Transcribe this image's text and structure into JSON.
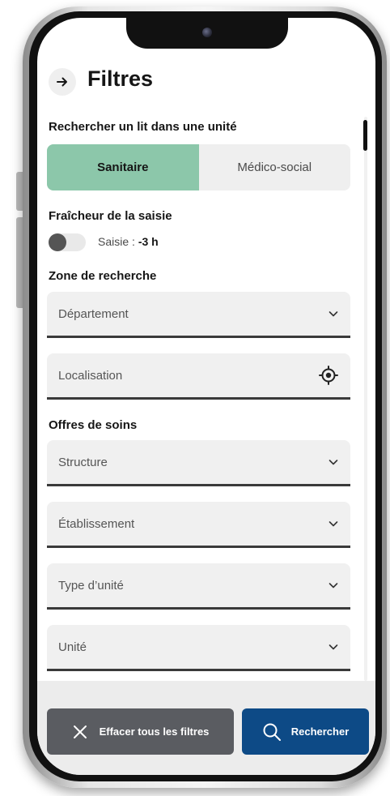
{
  "header": {
    "title": "Filtres"
  },
  "unit_search": {
    "label": "Rechercher un lit dans une unité",
    "options": [
      "Sanitaire",
      "Médico-social"
    ],
    "selected": "Sanitaire"
  },
  "freshness": {
    "label": "Fraîcheur de la saisie",
    "toggle_prefix": "Saisie : ",
    "toggle_value": "-3 h",
    "enabled": false
  },
  "zone": {
    "label": "Zone de recherche",
    "department_placeholder": "Département",
    "location_placeholder": "Localisation"
  },
  "care_offers": {
    "label": "Offres de soins",
    "structure_placeholder": "Structure",
    "establishment_placeholder": "Établissement",
    "unit_type_placeholder": "Type d’unité",
    "unit_placeholder": "Unité"
  },
  "actions": {
    "clear_label": "Effacer tous les filtres",
    "search_label": "Rechercher"
  },
  "icons": [
    "arrow-right-icon",
    "chevron-down-icon",
    "crosshair-icon",
    "close-icon",
    "search-icon"
  ],
  "colors": {
    "selected_segment": "#8cc7aa",
    "search_button": "#0d4a86",
    "clear_button": "#5a5c61"
  }
}
